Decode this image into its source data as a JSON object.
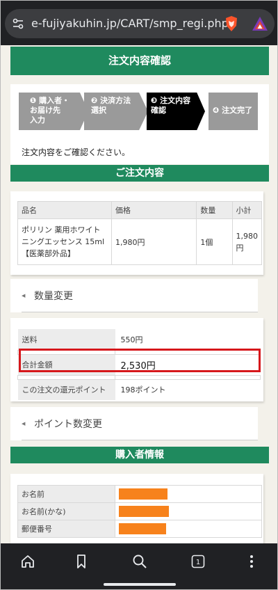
{
  "browser": {
    "url": "e-fujiyakuhin.jp/CART/smp_regi.php",
    "tab_count": "1",
    "icons": [
      "site-settings-icon",
      "brave-lion-icon",
      "rewards-triangle-icon",
      "home-icon",
      "bookmark-icon",
      "search-icon",
      "tabs-icon",
      "more-menu-icon"
    ]
  },
  "header": {
    "title": "注文内容確認"
  },
  "steps": {
    "items": [
      {
        "label_line1": "❶ 購入者・",
        "label_line2": "お届け先",
        "label_line3": "入力"
      },
      {
        "label_line1": "❷ 決済方法",
        "label_line2": "選択",
        "label_line3": ""
      },
      {
        "label_line1": "❸ 注文内容",
        "label_line2": "確認",
        "label_line3": ""
      },
      {
        "label_line1": "❹ 注文完了",
        "label_line2": "",
        "label_line3": ""
      }
    ],
    "instruction": "注文内容をご確認ください。"
  },
  "order": {
    "section_title": "ご注文内容",
    "columns": [
      "品名",
      "価格",
      "数量",
      "小計"
    ],
    "rows": [
      {
        "name": "ポリリン 薬用ホワイトニングエッセンス 15ml【医薬部外品】",
        "price": "1,980円",
        "qty": "1個",
        "subtotal": "1,980円"
      }
    ]
  },
  "qty_change": {
    "label": "数量変更"
  },
  "summary": {
    "shipping_label": "送料",
    "shipping_value": "550円",
    "total_label": "合計金額",
    "total_value": "2,530円",
    "points_label": "この注文の還元ポイント",
    "points_value": "198ポイント"
  },
  "point_change": {
    "label": "ポイント数変更"
  },
  "buyer": {
    "section_title": "購入者情報",
    "fields": [
      "お名前",
      "お名前(かな)",
      "郵便番号"
    ]
  },
  "colors": {
    "brand_green": "#1f8a5e",
    "step_active": "#000000",
    "step_inactive": "#9a9a9a",
    "highlight_red": "#d6171b",
    "redaction_orange": "#f7821c"
  }
}
